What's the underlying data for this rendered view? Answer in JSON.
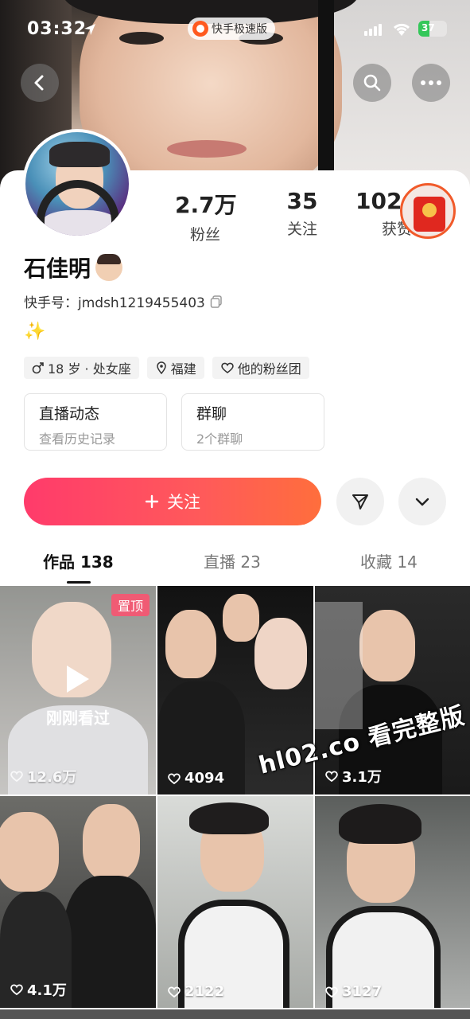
{
  "status_bar": {
    "time": "03:32",
    "app_name": "快手极速版",
    "battery": "37"
  },
  "profile": {
    "name": "石佳明",
    "kuaishou_id": "快手号：jmdsh1219455403",
    "bio": "✨",
    "stats": [
      {
        "value": "2.7万",
        "label": "粉丝"
      },
      {
        "value": "35",
        "label": "关注"
      },
      {
        "value": "102.4",
        "label": "获赞"
      }
    ],
    "tags": [
      {
        "icon": "male-icon",
        "label": "18 岁 · 处女座"
      },
      {
        "icon": "location-icon",
        "label": "福建"
      },
      {
        "icon": "heart-outline-icon",
        "label": "他的粉丝团"
      }
    ],
    "cards": [
      {
        "title": "直播动态",
        "subtitle": "查看历史记录"
      },
      {
        "title": "群聊",
        "subtitle": "2个群聊"
      }
    ]
  },
  "actions": {
    "follow_label": "关注"
  },
  "tabs": [
    {
      "label": "作品 138",
      "active": true
    },
    {
      "label": "直播 23",
      "active": false
    },
    {
      "label": "收藏 14",
      "active": false
    }
  ],
  "videos": [
    {
      "likes": "12.6万",
      "pinned_label": "置顶",
      "overlay": "刚刚看过"
    },
    {
      "likes": "4094"
    },
    {
      "likes": "3.1万"
    },
    {
      "likes": "4.1万"
    },
    {
      "likes": "2122"
    },
    {
      "likes": "3127"
    }
  ],
  "watermark": "hl02.co 看完整版",
  "colors": {
    "follow_gradient_start": "#ff3b6b",
    "follow_gradient_end": "#ff6e3c",
    "pin_badge": "#ff506e"
  }
}
